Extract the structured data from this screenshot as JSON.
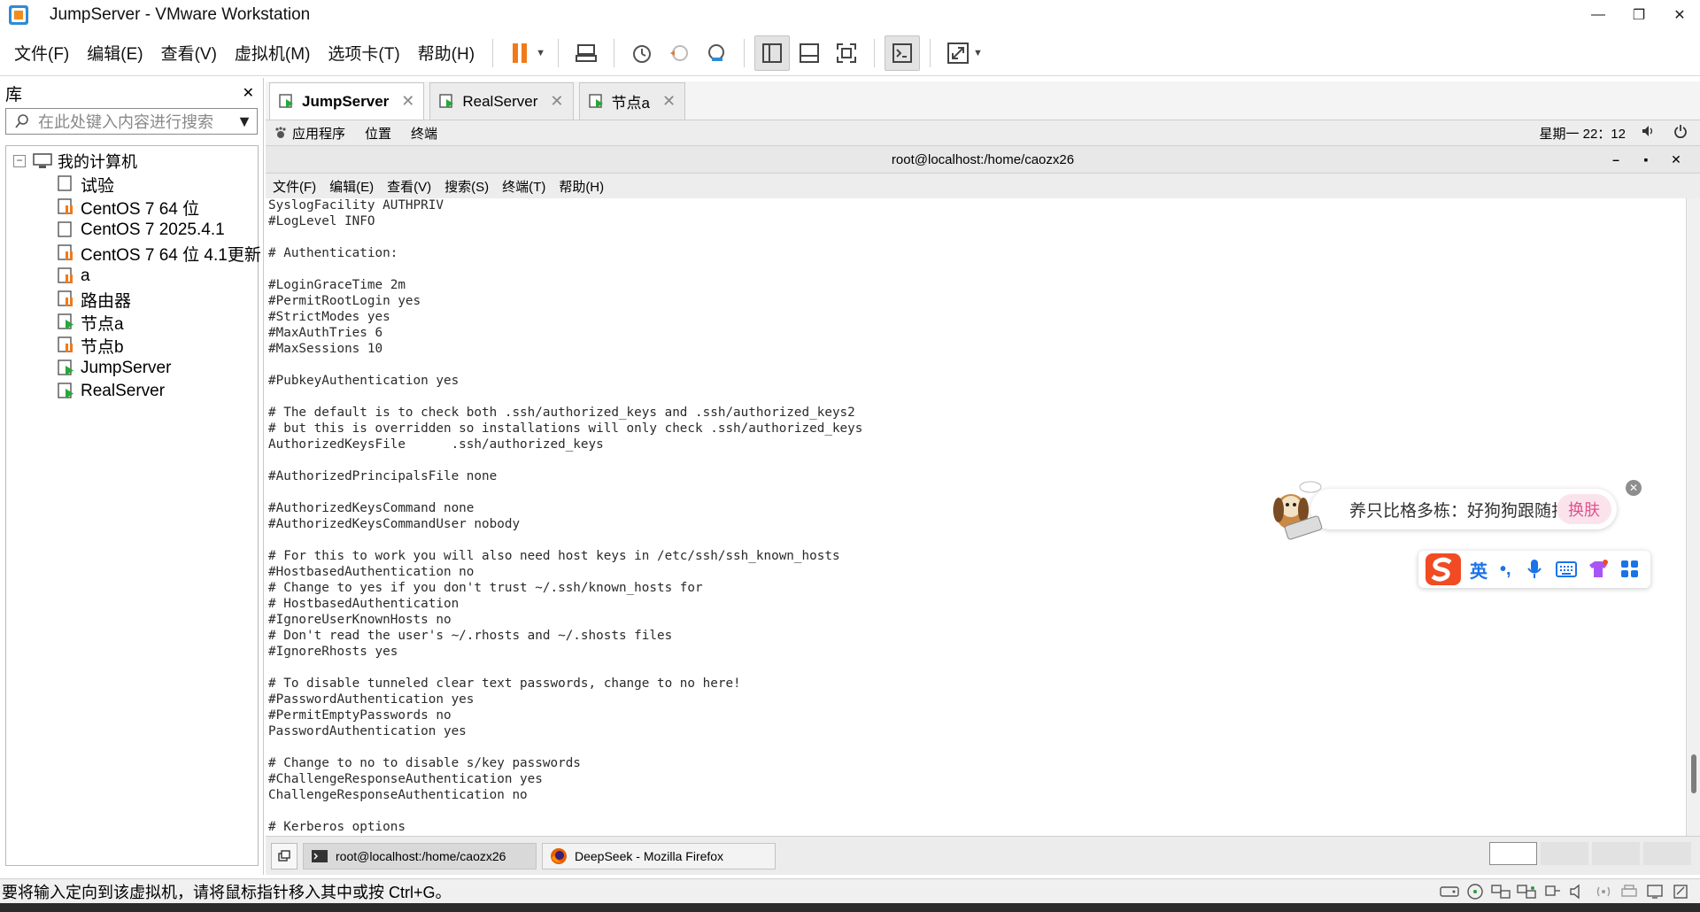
{
  "window": {
    "title": "JumpServer - VMware Workstation",
    "minimize": "—",
    "maximize": "❐",
    "close": "✕"
  },
  "menu": {
    "file": "文件(F)",
    "edit": "编辑(E)",
    "view": "查看(V)",
    "vm": "虚拟机(M)",
    "tabs": "选项卡(T)",
    "help": "帮助(H)"
  },
  "library": {
    "title": "库",
    "close": "✕",
    "search_placeholder": "在此处键入内容进行搜索",
    "root": "我的计算机",
    "items": [
      {
        "label": "试验",
        "state": "off"
      },
      {
        "label": "CentOS 7 64 位",
        "state": "paused"
      },
      {
        "label": "CentOS 7 2025.4.1",
        "state": "off"
      },
      {
        "label": "CentOS 7 64 位 4.1更新",
        "state": "paused"
      },
      {
        "label": "a",
        "state": "paused"
      },
      {
        "label": "路由器",
        "state": "paused"
      },
      {
        "label": "节点a",
        "state": "running"
      },
      {
        "label": "节点b",
        "state": "paused"
      },
      {
        "label": "JumpServer",
        "state": "running"
      },
      {
        "label": "RealServer",
        "state": "running"
      }
    ]
  },
  "tabs": [
    {
      "label": "JumpServer",
      "active": true
    },
    {
      "label": "RealServer",
      "active": false
    },
    {
      "label": "节点a",
      "active": false
    }
  ],
  "gnome": {
    "applications": "应用程序",
    "places": "位置",
    "terminal": "终端",
    "clock": "星期一 22：12"
  },
  "terminal": {
    "title": "root@localhost:/home/caozx26",
    "minimize": "–",
    "maximize": "▪",
    "close": "✕",
    "menu": [
      "文件(F)",
      "编辑(E)",
      "查看(V)",
      "搜索(S)",
      "终端(T)",
      "帮助(H)"
    ],
    "lines": [
      "SyslogFacility AUTHPRIV",
      "#LogLevel INFO",
      "",
      "# Authentication:",
      "",
      "#LoginGraceTime 2m",
      "#PermitRootLogin yes",
      "#StrictModes yes",
      "#MaxAuthTries 6",
      "#MaxSessions 10",
      "",
      "#PubkeyAuthentication yes",
      "",
      "# The default is to check both .ssh/authorized_keys and .ssh/authorized_keys2",
      "# but this is overridden so installations will only check .ssh/authorized_keys",
      "AuthorizedKeysFile      .ssh/authorized_keys",
      "",
      "#AuthorizedPrincipalsFile none",
      "",
      "#AuthorizedKeysCommand none",
      "#AuthorizedKeysCommandUser nobody",
      "",
      "# For this to work you will also need host keys in /etc/ssh/ssh_known_hosts",
      "#HostbasedAuthentication no",
      "# Change to yes if you don't trust ~/.ssh/known_hosts for",
      "# HostbasedAuthentication",
      "#IgnoreUserKnownHosts no",
      "# Don't read the user's ~/.rhosts and ~/.shosts files",
      "#IgnoreRhosts yes",
      "",
      "# To disable tunneled clear text passwords, change to no here!",
      "#PasswordAuthentication yes",
      "#PermitEmptyPasswords no",
      "PasswordAuthentication yes",
      "",
      "# Change to no to disable s/key passwords",
      "#ChallengeResponseAuthentication yes",
      "ChallengeResponseAuthentication no",
      "",
      "# Kerberos options"
    ]
  },
  "taskbar": {
    "task1": "root@localhost:/home/caozx26",
    "task2": "DeepSeek - Mozilla Firefox"
  },
  "ime": {
    "tip": "养只比格多栋：好狗狗跟随打字",
    "swap": "换肤",
    "close": "✕",
    "mode": "英",
    "punct": "•,"
  },
  "status": {
    "message": "要将输入定向到该虚拟机，请将鼠标指针移入其中或按 Ctrl+G。"
  }
}
